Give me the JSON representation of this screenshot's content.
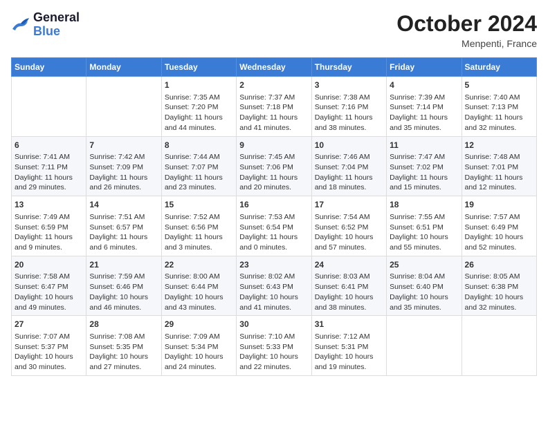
{
  "header": {
    "logo_line1": "General",
    "logo_line2": "Blue",
    "month": "October 2024",
    "location": "Menpenti, France"
  },
  "days_of_week": [
    "Sunday",
    "Monday",
    "Tuesday",
    "Wednesday",
    "Thursday",
    "Friday",
    "Saturday"
  ],
  "weeks": [
    [
      {
        "day": "",
        "info": ""
      },
      {
        "day": "",
        "info": ""
      },
      {
        "day": "1",
        "info": "Sunrise: 7:35 AM\nSunset: 7:20 PM\nDaylight: 11 hours\nand 44 minutes."
      },
      {
        "day": "2",
        "info": "Sunrise: 7:37 AM\nSunset: 7:18 PM\nDaylight: 11 hours\nand 41 minutes."
      },
      {
        "day": "3",
        "info": "Sunrise: 7:38 AM\nSunset: 7:16 PM\nDaylight: 11 hours\nand 38 minutes."
      },
      {
        "day": "4",
        "info": "Sunrise: 7:39 AM\nSunset: 7:14 PM\nDaylight: 11 hours\nand 35 minutes."
      },
      {
        "day": "5",
        "info": "Sunrise: 7:40 AM\nSunset: 7:13 PM\nDaylight: 11 hours\nand 32 minutes."
      }
    ],
    [
      {
        "day": "6",
        "info": "Sunrise: 7:41 AM\nSunset: 7:11 PM\nDaylight: 11 hours\nand 29 minutes."
      },
      {
        "day": "7",
        "info": "Sunrise: 7:42 AM\nSunset: 7:09 PM\nDaylight: 11 hours\nand 26 minutes."
      },
      {
        "day": "8",
        "info": "Sunrise: 7:44 AM\nSunset: 7:07 PM\nDaylight: 11 hours\nand 23 minutes."
      },
      {
        "day": "9",
        "info": "Sunrise: 7:45 AM\nSunset: 7:06 PM\nDaylight: 11 hours\nand 20 minutes."
      },
      {
        "day": "10",
        "info": "Sunrise: 7:46 AM\nSunset: 7:04 PM\nDaylight: 11 hours\nand 18 minutes."
      },
      {
        "day": "11",
        "info": "Sunrise: 7:47 AM\nSunset: 7:02 PM\nDaylight: 11 hours\nand 15 minutes."
      },
      {
        "day": "12",
        "info": "Sunrise: 7:48 AM\nSunset: 7:01 PM\nDaylight: 11 hours\nand 12 minutes."
      }
    ],
    [
      {
        "day": "13",
        "info": "Sunrise: 7:49 AM\nSunset: 6:59 PM\nDaylight: 11 hours\nand 9 minutes."
      },
      {
        "day": "14",
        "info": "Sunrise: 7:51 AM\nSunset: 6:57 PM\nDaylight: 11 hours\nand 6 minutes."
      },
      {
        "day": "15",
        "info": "Sunrise: 7:52 AM\nSunset: 6:56 PM\nDaylight: 11 hours\nand 3 minutes."
      },
      {
        "day": "16",
        "info": "Sunrise: 7:53 AM\nSunset: 6:54 PM\nDaylight: 11 hours\nand 0 minutes."
      },
      {
        "day": "17",
        "info": "Sunrise: 7:54 AM\nSunset: 6:52 PM\nDaylight: 10 hours\nand 57 minutes."
      },
      {
        "day": "18",
        "info": "Sunrise: 7:55 AM\nSunset: 6:51 PM\nDaylight: 10 hours\nand 55 minutes."
      },
      {
        "day": "19",
        "info": "Sunrise: 7:57 AM\nSunset: 6:49 PM\nDaylight: 10 hours\nand 52 minutes."
      }
    ],
    [
      {
        "day": "20",
        "info": "Sunrise: 7:58 AM\nSunset: 6:47 PM\nDaylight: 10 hours\nand 49 minutes."
      },
      {
        "day": "21",
        "info": "Sunrise: 7:59 AM\nSunset: 6:46 PM\nDaylight: 10 hours\nand 46 minutes."
      },
      {
        "day": "22",
        "info": "Sunrise: 8:00 AM\nSunset: 6:44 PM\nDaylight: 10 hours\nand 43 minutes."
      },
      {
        "day": "23",
        "info": "Sunrise: 8:02 AM\nSunset: 6:43 PM\nDaylight: 10 hours\nand 41 minutes."
      },
      {
        "day": "24",
        "info": "Sunrise: 8:03 AM\nSunset: 6:41 PM\nDaylight: 10 hours\nand 38 minutes."
      },
      {
        "day": "25",
        "info": "Sunrise: 8:04 AM\nSunset: 6:40 PM\nDaylight: 10 hours\nand 35 minutes."
      },
      {
        "day": "26",
        "info": "Sunrise: 8:05 AM\nSunset: 6:38 PM\nDaylight: 10 hours\nand 32 minutes."
      }
    ],
    [
      {
        "day": "27",
        "info": "Sunrise: 7:07 AM\nSunset: 5:37 PM\nDaylight: 10 hours\nand 30 minutes."
      },
      {
        "day": "28",
        "info": "Sunrise: 7:08 AM\nSunset: 5:35 PM\nDaylight: 10 hours\nand 27 minutes."
      },
      {
        "day": "29",
        "info": "Sunrise: 7:09 AM\nSunset: 5:34 PM\nDaylight: 10 hours\nand 24 minutes."
      },
      {
        "day": "30",
        "info": "Sunrise: 7:10 AM\nSunset: 5:33 PM\nDaylight: 10 hours\nand 22 minutes."
      },
      {
        "day": "31",
        "info": "Sunrise: 7:12 AM\nSunset: 5:31 PM\nDaylight: 10 hours\nand 19 minutes."
      },
      {
        "day": "",
        "info": ""
      },
      {
        "day": "",
        "info": ""
      }
    ]
  ]
}
